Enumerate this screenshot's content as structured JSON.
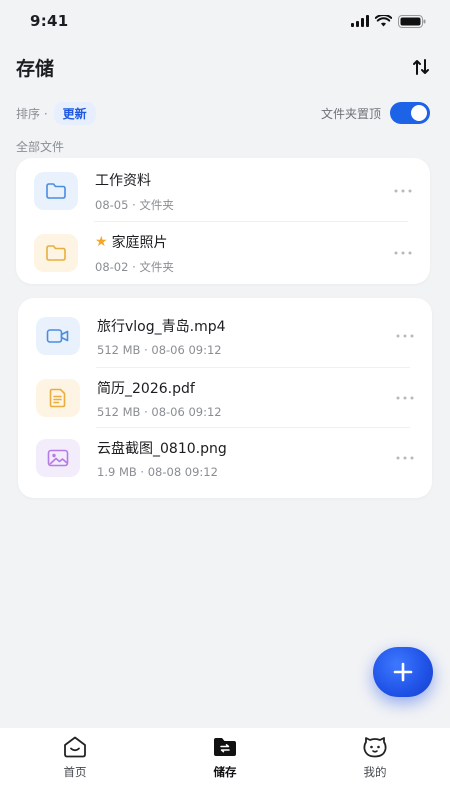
{
  "status_bar": {
    "time": "9:41"
  },
  "header": {
    "title": "存储"
  },
  "sort": {
    "label": "排序 ·",
    "value": "更新"
  },
  "folder_top": {
    "label": "文件夹置顶",
    "enabled": true
  },
  "section": {
    "label": "全部文件"
  },
  "folders": [
    {
      "name": "工作资料",
      "meta": "08-05 · 文件夹",
      "icon": "folder-icon",
      "color": "#4a8de0",
      "starred": false
    },
    {
      "name": "家庭照片",
      "meta": "08-02 · 文件夹",
      "icon": "folder-icon",
      "color": "#e9ae3d",
      "starred": true
    }
  ],
  "files": [
    {
      "name": "旅行vlog_青岛.mp4",
      "meta": "512 MB · 08-06 09:12",
      "icon": "video-icon",
      "color": "#4a8de0"
    },
    {
      "name": "简历_2026.pdf",
      "meta": "512 MB · 08-06 09:12",
      "icon": "document-icon",
      "color": "#e9ae3d"
    },
    {
      "name": "云盘截图_0810.png",
      "meta": "1.9 MB · 08-08 09:12",
      "icon": "image-icon",
      "color": "#b57be6"
    }
  ],
  "tabs": [
    {
      "label": "首页",
      "icon": "home-icon",
      "active": false
    },
    {
      "label": "储存",
      "icon": "storage-folder-icon",
      "active": true
    },
    {
      "label": "我的",
      "icon": "profile-face-icon",
      "active": false
    }
  ],
  "colors": {
    "accent": "#1d63e8",
    "background": "#f2f3f5"
  }
}
